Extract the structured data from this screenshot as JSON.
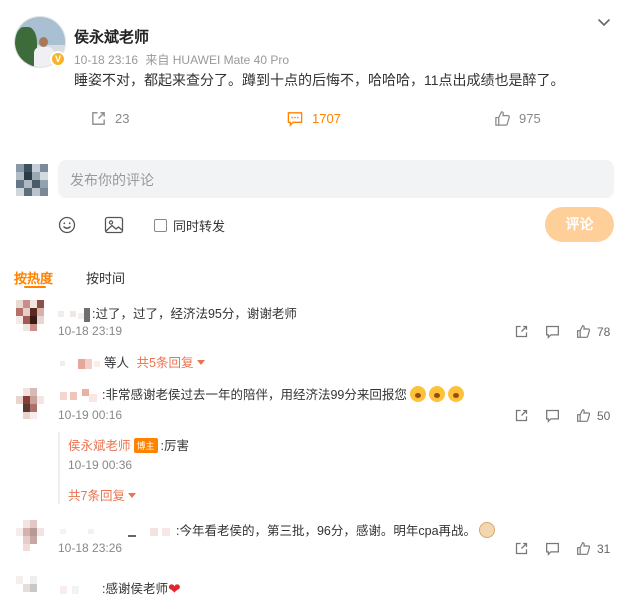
{
  "post": {
    "author": "侯永斌老师",
    "time": "10-18 23:16",
    "source": "来自 HUAWEI Mate 40 Pro",
    "text": "睡姿不对，都起来查分了。蹲到十点的后悔不，哈哈哈，11点出成绩也是醉了。",
    "shares": "23",
    "comments": "1707",
    "likes": "975",
    "verified_badge": "V"
  },
  "composer": {
    "placeholder": "发布你的评论",
    "repost_label": "同时转发",
    "submit_label": "评论"
  },
  "tabs": {
    "hot": "按热度",
    "time": "按时间"
  },
  "comments": [
    {
      "text": ":过了，过了，经济法95分，谢谢老师",
      "time": "10-18 23:19",
      "likes": "78",
      "reply_preview": "等人",
      "reply_count": "共5条回复"
    },
    {
      "text": ":非常感谢老侯过去一年的陪伴，用经济法99分来回报您",
      "time": "10-19 00:16",
      "likes": "50",
      "reply_author": "侯永斌老师",
      "reply_tag": "博主",
      "reply_text": ":厉害",
      "reply_time": "10-19 00:36",
      "reply_count": "共7条回复"
    },
    {
      "text": ":今年看老侯的，第三批，96分，感谢。明年cpa再战。",
      "time": "10-18 23:26",
      "likes": "31"
    },
    {
      "text": ":感谢侯老师"
    }
  ],
  "icons": {
    "share": "share-icon",
    "comment": "comment-icon",
    "like": "thumbs-up-icon",
    "emoji": "emoji-icon",
    "image": "image-icon",
    "chevron": "chevron-down-icon"
  },
  "colors": {
    "accent": "#ff8200",
    "reply_link": "#eb7350",
    "submit_disabled": "#ffcf9a",
    "verified": "#f7b329"
  }
}
